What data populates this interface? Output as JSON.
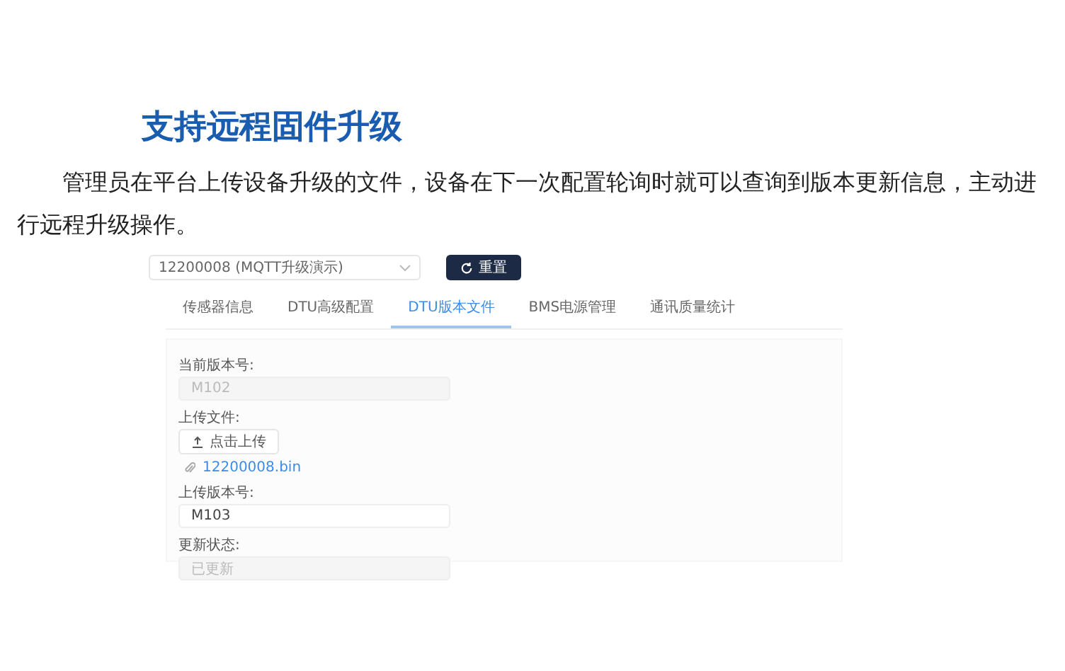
{
  "heading": "支持远程固件升级",
  "paragraph": "管理员在平台上传设备升级的文件，设备在下一次配置轮询时就可以查询到版本更新信息，主动进行远程升级操作。",
  "screenshot": {
    "device_select": {
      "value": "12200008 (MQTT升级演示)"
    },
    "reset_button": {
      "label": "重置"
    },
    "tabs": [
      {
        "label": "传感器信息",
        "selected": false
      },
      {
        "label": "DTU高级配置",
        "selected": false
      },
      {
        "label": "DTU版本文件",
        "selected": true
      },
      {
        "label": "BMS电源管理",
        "selected": false
      },
      {
        "label": "通讯质量统计",
        "selected": false
      }
    ],
    "form": [
      {
        "kind": "field",
        "label": "当前版本号:",
        "value": "M102",
        "disabled": true
      },
      {
        "kind": "upload",
        "label": "上传文件:",
        "button": "点击上传",
        "file": "12200008.bin"
      },
      {
        "kind": "field",
        "label": "上传版本号:",
        "value": "M103",
        "disabled": false
      },
      {
        "kind": "field",
        "label": "更新状态:",
        "value": "已更新",
        "disabled": true
      }
    ]
  }
}
